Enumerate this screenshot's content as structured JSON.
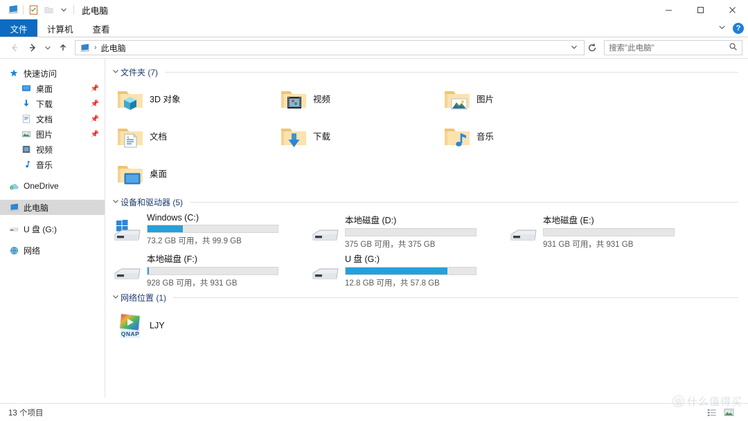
{
  "window": {
    "title": "此电脑",
    "quick_access": {
      "explorer_icon": "computer-icon",
      "properties_icon": "properties-checklist-icon",
      "newfolder_icon": "new-folder-icon",
      "customize_icon": "chevron-down-icon"
    },
    "controls": {
      "minimize": "minimize-icon",
      "maximize": "maximize-icon",
      "close": "close-icon"
    }
  },
  "ribbon": {
    "tabs": [
      {
        "label": "文件",
        "active": true
      },
      {
        "label": "计算机",
        "active": false
      },
      {
        "label": "查看",
        "active": false
      }
    ],
    "collapse_icon": "chevron-down-icon",
    "help_label": "?"
  },
  "addressbar": {
    "back_icon": "arrow-left-icon",
    "forward_icon": "arrow-right-icon",
    "recent_icon": "chevron-down-icon",
    "up_icon": "arrow-up-icon",
    "crumb_icon": "computer-icon",
    "crumb": "此电脑",
    "dropdown_icon": "chevron-down-icon",
    "refresh_icon": "refresh-icon"
  },
  "search": {
    "placeholder": "搜索\"此电脑\"",
    "icon": "search-icon"
  },
  "sidebar": {
    "items": [
      {
        "label": "快速访问",
        "icon": "star-pin-icon",
        "level": 0,
        "pinned": false,
        "selected": false
      },
      {
        "label": "桌面",
        "icon": "desktop-icon",
        "level": 1,
        "pinned": true,
        "selected": false
      },
      {
        "label": "下载",
        "icon": "downloads-icon",
        "level": 1,
        "pinned": true,
        "selected": false
      },
      {
        "label": "文档",
        "icon": "documents-icon",
        "level": 1,
        "pinned": true,
        "selected": false
      },
      {
        "label": "图片",
        "icon": "pictures-icon",
        "level": 1,
        "pinned": true,
        "selected": false
      },
      {
        "label": "视频",
        "icon": "videos-icon",
        "level": 1,
        "pinned": false,
        "selected": false
      },
      {
        "label": "音乐",
        "icon": "music-icon",
        "level": 1,
        "pinned": false,
        "selected": false
      },
      {
        "label": "OneDrive",
        "icon": "onedrive-cloud-icon",
        "level": 0,
        "pinned": false,
        "selected": false
      },
      {
        "label": "此电脑",
        "icon": "computer-icon",
        "level": 0,
        "pinned": false,
        "selected": true
      },
      {
        "label": "U 盘 (G:)",
        "icon": "usb-drive-icon",
        "level": 0,
        "pinned": false,
        "selected": false
      },
      {
        "label": "网络",
        "icon": "network-icon",
        "level": 0,
        "pinned": false,
        "selected": false
      }
    ]
  },
  "main": {
    "groups": [
      {
        "title": "文件夹 (7)",
        "count": 7
      },
      {
        "title": "设备和驱动器 (5)",
        "count": 5
      },
      {
        "title": "网络位置 (1)",
        "count": 1
      }
    ],
    "folders": [
      {
        "label": "3D 对象",
        "icon": "folder-3dobjects-icon"
      },
      {
        "label": "视频",
        "icon": "folder-videos-icon"
      },
      {
        "label": "图片",
        "icon": "folder-pictures-icon"
      },
      {
        "label": "文档",
        "icon": "folder-documents-icon"
      },
      {
        "label": "下载",
        "icon": "folder-downloads-icon"
      },
      {
        "label": "音乐",
        "icon": "folder-music-icon"
      },
      {
        "label": "桌面",
        "icon": "folder-desktop-icon"
      }
    ],
    "drives": [
      {
        "name": "Windows (C:)",
        "capacity_text": "73.2 GB 可用，共 99.9 GB",
        "used_percent": 27,
        "icon": "windows-drive-icon",
        "bar_color": "#26a0da"
      },
      {
        "name": "本地磁盘 (D:)",
        "capacity_text": "375 GB 可用，共 375 GB",
        "used_percent": 0,
        "icon": "drive-icon",
        "bar_color": "#26a0da"
      },
      {
        "name": "本地磁盘 (E:)",
        "capacity_text": "931 GB 可用，共 931 GB",
        "used_percent": 0,
        "icon": "drive-icon",
        "bar_color": "#26a0da"
      },
      {
        "name": "本地磁盘 (F:)",
        "capacity_text": "928 GB 可用，共 931 GB",
        "used_percent": 1,
        "icon": "drive-icon",
        "bar_color": "#26a0da"
      },
      {
        "name": "U 盘 (G:)",
        "capacity_text": "12.8 GB 可用，共 57.8 GB",
        "used_percent": 78,
        "icon": "drive-icon",
        "bar_color": "#26a0da"
      }
    ],
    "network_locations": [
      {
        "label": "LJY",
        "icon": "qnap-nas-icon",
        "badge_text": "QNAP"
      }
    ]
  },
  "statusbar": {
    "item_count_text": "13 个项目",
    "view_details_icon": "details-view-icon",
    "view_large_icon": "large-icons-view-icon"
  },
  "watermark": {
    "mark": "值",
    "text": "什么值得买"
  },
  "colors": {
    "accent": "#0d6cbf",
    "bar_fill": "#26a0da",
    "group_title": "#1f3b6e",
    "selection": "#d8d8d8",
    "folder_yellow": "#f6d58a"
  }
}
